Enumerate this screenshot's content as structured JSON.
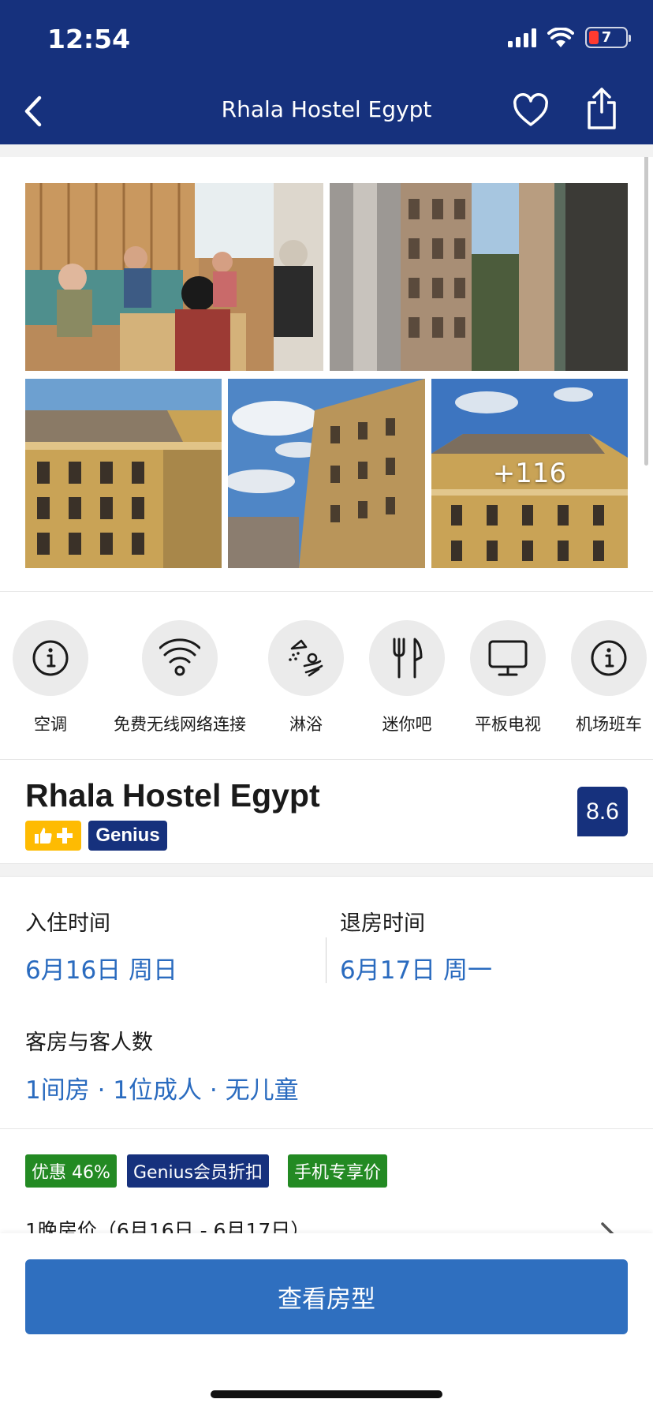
{
  "status_bar": {
    "time": "12:54",
    "battery_level": "7",
    "icons": [
      "cellular-signal-icon",
      "wifi-icon",
      "battery-charging-icon"
    ]
  },
  "nav": {
    "title": "Rhala Hostel Egypt",
    "back_icon": "chevron-left-icon",
    "favorite_icon": "heart-icon",
    "share_icon": "share-icon"
  },
  "gallery": {
    "more_count": "+116",
    "photos": [
      {
        "subject": "common room with guests on sofa"
      },
      {
        "subject": "street view between buildings"
      },
      {
        "subject": "yellow building facade"
      },
      {
        "subject": "building facade and cloudy sky"
      },
      {
        "subject": "building facade and blue sky"
      }
    ]
  },
  "amenities": [
    {
      "label": "空调",
      "icon": "info-icon"
    },
    {
      "label": "免费无线网络连接",
      "icon": "wifi-icon"
    },
    {
      "label": "淋浴",
      "icon": "shower-icon"
    },
    {
      "label": "迷你吧",
      "icon": "cutlery-icon"
    },
    {
      "label": "平板电视",
      "icon": "monitor-icon"
    },
    {
      "label": "机场班车",
      "icon": "info-icon"
    }
  ],
  "property": {
    "name": "Rhala Hostel Egypt",
    "genius_label": "Genius",
    "score": "8.6"
  },
  "booking": {
    "checkin_label": "入住时间",
    "checkin_value": "6月16日 周日",
    "checkout_label": "退房时间",
    "checkout_value": "6月17日 周一",
    "rooms_label": "客房与客人数",
    "rooms_value": "1间房 · 1位成人 · 无儿童"
  },
  "deals": {
    "tags": [
      "优惠 46%",
      "Genius会员折扣",
      "手机专享价"
    ],
    "price_label": "1晚房价（6月16日 - 6月17日）"
  },
  "cta": {
    "label": "查看房型"
  },
  "colors": {
    "brand_navy": "#16317d",
    "link_blue": "#2a6bbf",
    "cta_blue": "#2f6fbf",
    "deal_green": "#238a23",
    "genius_yellow": "#febb02"
  }
}
